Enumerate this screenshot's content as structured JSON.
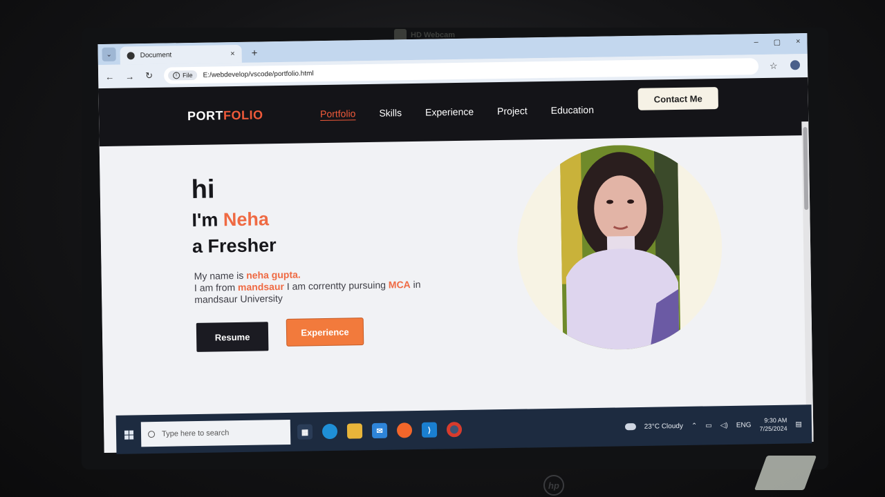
{
  "bezel": {
    "camera_label": "HD Webcam"
  },
  "browser": {
    "tab_title": "Document",
    "tab_close": "×",
    "new_tab": "+",
    "window_controls": [
      "–",
      "▢",
      "×"
    ],
    "url_chip": "File",
    "url": "E:/webdevelop/vscode/portfolio.html"
  },
  "site": {
    "logo_main": "PORT",
    "logo_accent": "FOLIO",
    "nav": [
      "Portfolio",
      "Skills",
      "Experience",
      "Project",
      "Education"
    ],
    "contact_label": "Contact Me",
    "hero": {
      "greeting": "hi",
      "intro_prefix": "I'm ",
      "name": "Neha",
      "role": "a Fresher",
      "bio_line1_prefix": "My name is ",
      "bio_name": "neha gupta.",
      "bio_line2_prefix": "I am from ",
      "bio_city": "mandsaur",
      "bio_line2_mid": " I am correntty pursuing ",
      "bio_degree": "MCA",
      "bio_line2_suffix": " in",
      "bio_line3": "mandsaur University",
      "resume_label": "Resume",
      "experience_label": "Experience"
    },
    "colors": {
      "accent": "#ef6a43",
      "dark": "#141418"
    }
  },
  "taskbar": {
    "search_placeholder": "Type here to search",
    "weather": "23°C  Cloudy",
    "language": "ENG",
    "time": "9:30 AM",
    "date": "7/25/2024"
  }
}
